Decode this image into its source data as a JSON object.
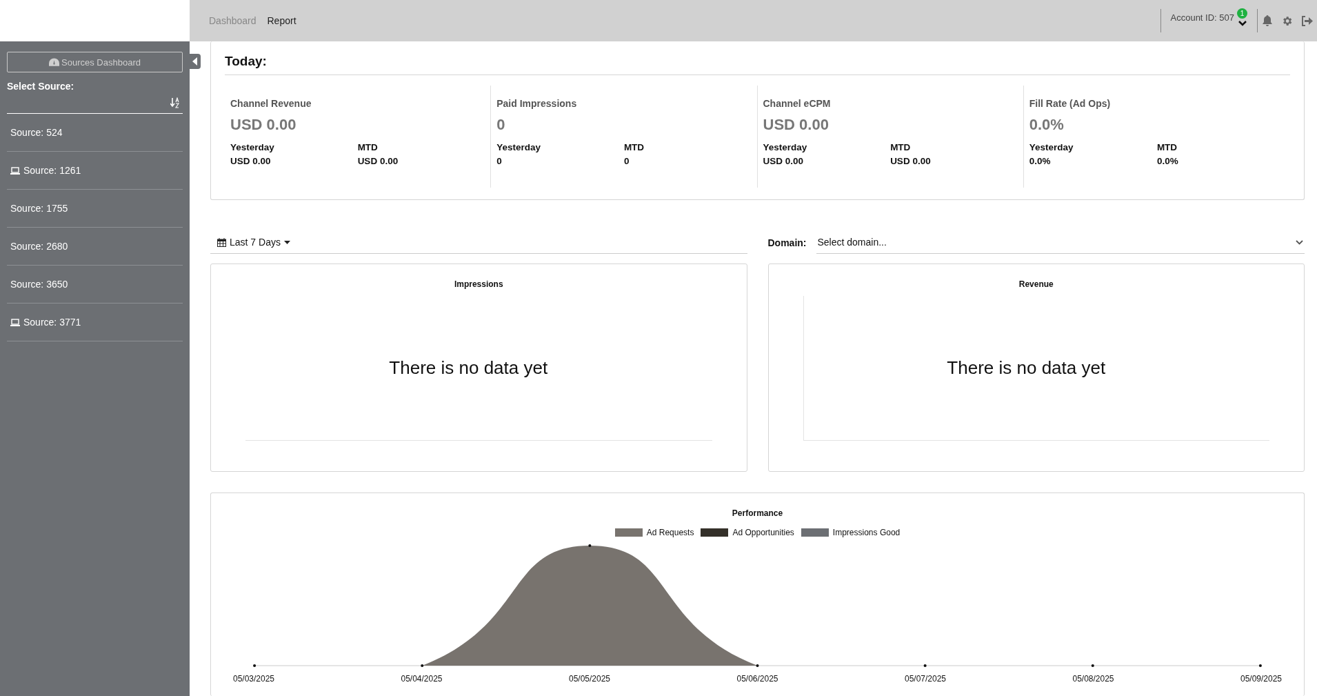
{
  "topbar": {
    "nav": [
      {
        "label": "Dashboard",
        "selected": false
      },
      {
        "label": "Report",
        "selected": true
      }
    ],
    "account": "Account ID: 507",
    "notification_count": "1"
  },
  "sidebar": {
    "dashboard_button": "Sources Dashboard",
    "select_label": "Select Source:",
    "sources": [
      {
        "label": "Source: 524",
        "kind": "plain"
      },
      {
        "label": "Source: 1261",
        "kind": "device"
      },
      {
        "label": "Source: 1755",
        "kind": "plain"
      },
      {
        "label": "Source: 2680",
        "kind": "plain"
      },
      {
        "label": "Source: 3650",
        "kind": "plain"
      },
      {
        "label": "Source: 3771",
        "kind": "device"
      }
    ]
  },
  "today": {
    "title": "Today:",
    "stats": [
      {
        "label": "Channel Revenue",
        "value": "USD 0.00",
        "yesterday_label": "Yesterday",
        "yesterday": "USD 0.00",
        "mtd_label": "MTD",
        "mtd": "USD 0.00"
      },
      {
        "label": "Paid Impressions",
        "value": "0",
        "yesterday_label": "Yesterday",
        "yesterday": "0",
        "mtd_label": "MTD",
        "mtd": "0"
      },
      {
        "label": "Channel eCPM",
        "value": "USD 0.00",
        "yesterday_label": "Yesterday",
        "yesterday": "USD 0.00",
        "mtd_label": "MTD",
        "mtd": "USD 0.00"
      },
      {
        "label": "Fill Rate (Ad Ops)",
        "value": "0.0%",
        "yesterday_label": "Yesterday",
        "yesterday": "0.0%",
        "mtd_label": "MTD",
        "mtd": "0.0%"
      }
    ]
  },
  "filters": {
    "date_range": "Last 7 Days",
    "domain_label": "Domain:",
    "domain_placeholder": "Select domain..."
  },
  "panels": [
    {
      "title": "Impressions",
      "message": "There is no data yet"
    },
    {
      "title": "Revenue",
      "message": "There is no data yet"
    }
  ],
  "performance": {
    "title": "Performance",
    "legend": [
      {
        "name": "Ad Requests",
        "color": "#78736e"
      },
      {
        "name": "Ad Opportunities",
        "color": "#343029"
      },
      {
        "name": "Impressions Good",
        "color": "#6c6f73"
      }
    ],
    "x_labels": [
      "05/03/2025",
      "05/04/2025",
      "05/05/2025",
      "05/06/2025",
      "05/07/2025",
      "05/08/2025",
      "05/09/2025"
    ]
  }
}
